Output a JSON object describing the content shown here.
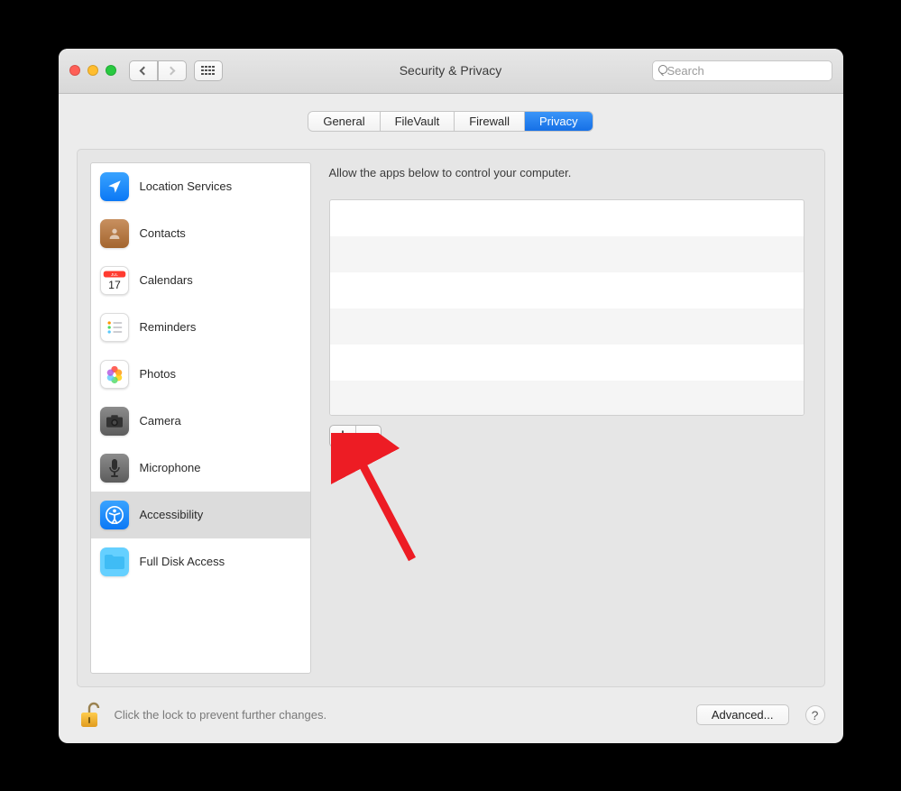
{
  "window": {
    "title": "Security & Privacy"
  },
  "search": {
    "placeholder": "Search",
    "value": ""
  },
  "tabs": [
    {
      "label": "General",
      "active": false
    },
    {
      "label": "FileVault",
      "active": false
    },
    {
      "label": "Firewall",
      "active": false
    },
    {
      "label": "Privacy",
      "active": true
    }
  ],
  "sidebar": {
    "items": [
      {
        "icon": "location-icon",
        "label": "Location Services",
        "selected": false
      },
      {
        "icon": "contacts-icon",
        "label": "Contacts",
        "selected": false
      },
      {
        "icon": "calendar-icon",
        "label": "Calendars",
        "selected": false
      },
      {
        "icon": "reminders-icon",
        "label": "Reminders",
        "selected": false
      },
      {
        "icon": "photos-icon",
        "label": "Photos",
        "selected": false
      },
      {
        "icon": "camera-icon",
        "label": "Camera",
        "selected": false
      },
      {
        "icon": "microphone-icon",
        "label": "Microphone",
        "selected": false
      },
      {
        "icon": "accessibility-icon",
        "label": "Accessibility",
        "selected": true
      },
      {
        "icon": "folder-icon",
        "label": "Full Disk Access",
        "selected": false
      }
    ]
  },
  "detail": {
    "description": "Allow the apps below to control your computer.",
    "app_rows": [
      "",
      "",
      "",
      "",
      "",
      ""
    ]
  },
  "buttons": {
    "add": "＋",
    "remove": "－",
    "advanced": "Advanced...",
    "help": "?"
  },
  "footer": {
    "lock_hint": "Click the lock to prevent further changes."
  },
  "colors": {
    "accent_blue": "#1a7bf2",
    "arrow_red": "#ed1c24"
  }
}
